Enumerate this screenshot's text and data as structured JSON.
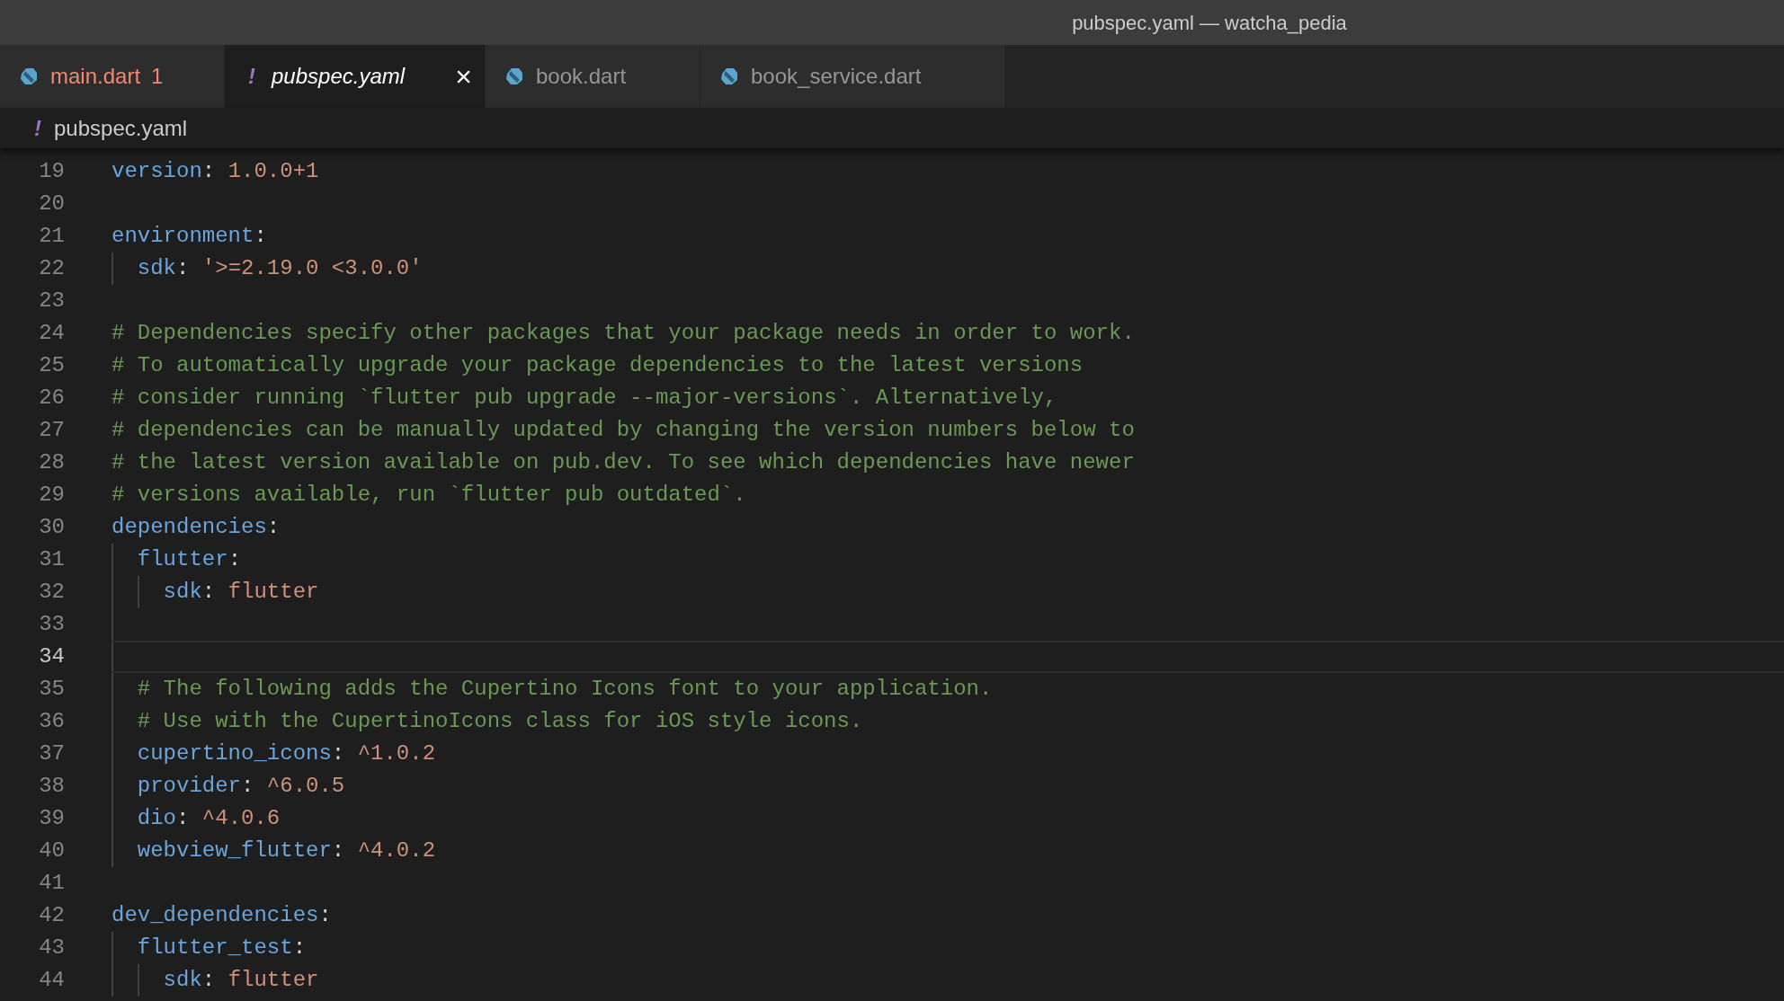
{
  "window": {
    "title": "pubspec.yaml — watcha_pedia"
  },
  "tabs": [
    {
      "kind": "dart",
      "label": "main.dart",
      "problems": "1",
      "error": true,
      "selected": false
    },
    {
      "kind": "yaml",
      "icon_text": "!",
      "label": "pubspec.yaml",
      "close": "×",
      "error": false,
      "selected": true
    },
    {
      "kind": "dart",
      "label": "book.dart",
      "error": false,
      "selected": false
    },
    {
      "kind": "dart",
      "label": "book_service.dart",
      "error": false,
      "selected": false
    }
  ],
  "breadcrumb": {
    "icon_text": "!",
    "label": "pubspec.yaml"
  },
  "editor": {
    "lines": [
      {
        "number": "19",
        "tokens": [
          {
            "kind": "key",
            "text": "version"
          },
          {
            "kind": "punct",
            "text": ": "
          },
          {
            "kind": "value",
            "text": "1.0.0+1"
          }
        ]
      },
      {
        "number": "20"
      },
      {
        "number": "21",
        "tokens": [
          {
            "kind": "key",
            "text": "environment"
          },
          {
            "kind": "punct",
            "text": ":"
          }
        ],
        "children": [
          {
            "number": "22",
            "tokens": [
              {
                "kind": "key",
                "text": "sdk"
              },
              {
                "kind": "punct",
                "text": ": "
              },
              {
                "kind": "value",
                "text": "'>=2.19.0 <3.0.0'"
              }
            ]
          }
        ]
      },
      {
        "number": "23"
      },
      {
        "number": "24",
        "tokens": [
          {
            "kind": "comment",
            "text": "# Dependencies specify other packages that your package needs in order to work."
          }
        ]
      },
      {
        "number": "25",
        "tokens": [
          {
            "kind": "comment",
            "text": "# To automatically upgrade your package dependencies to the latest versions"
          }
        ]
      },
      {
        "number": "26",
        "tokens": [
          {
            "kind": "comment",
            "text": "# consider running `flutter pub upgrade --major-versions`. Alternatively,"
          }
        ]
      },
      {
        "number": "27",
        "tokens": [
          {
            "kind": "comment",
            "text": "# dependencies can be manually updated by changing the version numbers below to"
          }
        ]
      },
      {
        "number": "28",
        "tokens": [
          {
            "kind": "comment",
            "text": "# the latest version available on pub.dev. To see which dependencies have newer"
          }
        ]
      },
      {
        "number": "29",
        "tokens": [
          {
            "kind": "comment",
            "text": "# versions available, run `flutter pub outdated`."
          }
        ]
      },
      {
        "number": "30",
        "tokens": [
          {
            "kind": "key",
            "text": "dependencies"
          },
          {
            "kind": "punct",
            "text": ":"
          }
        ],
        "children": [
          {
            "number": "31",
            "tokens": [
              {
                "kind": "key",
                "text": "flutter"
              },
              {
                "kind": "punct",
                "text": ":"
              }
            ],
            "children": [
              {
                "number": "32",
                "tokens": [
                  {
                    "kind": "key",
                    "text": "sdk"
                  },
                  {
                    "kind": "punct",
                    "text": ": "
                  },
                  {
                    "kind": "value",
                    "text": "flutter"
                  }
                ]
              }
            ]
          },
          {
            "number": "33"
          },
          {
            "number": "34",
            "current": true
          },
          {
            "number": "35",
            "tokens": [
              {
                "kind": "comment",
                "text": "# The following adds the Cupertino Icons font to your application."
              }
            ]
          },
          {
            "number": "36",
            "tokens": [
              {
                "kind": "comment",
                "text": "# Use with the CupertinoIcons class for iOS style icons."
              }
            ]
          },
          {
            "number": "37",
            "tokens": [
              {
                "kind": "key",
                "text": "cupertino_icons"
              },
              {
                "kind": "punct",
                "text": ": "
              },
              {
                "kind": "value",
                "text": "^1.0.2"
              }
            ]
          },
          {
            "number": "38",
            "tokens": [
              {
                "kind": "key",
                "text": "provider"
              },
              {
                "kind": "punct",
                "text": ": "
              },
              {
                "kind": "value",
                "text": "^6.0.5"
              }
            ]
          },
          {
            "number": "39",
            "tokens": [
              {
                "kind": "key",
                "text": "dio"
              },
              {
                "kind": "punct",
                "text": ": "
              },
              {
                "kind": "value",
                "text": "^4.0.6"
              }
            ]
          },
          {
            "number": "40",
            "tokens": [
              {
                "kind": "key",
                "text": "webview_flutter"
              },
              {
                "kind": "punct",
                "text": ": "
              },
              {
                "kind": "value",
                "text": "^4.0.2"
              }
            ]
          }
        ]
      },
      {
        "number": "41"
      },
      {
        "number": "42",
        "tokens": [
          {
            "kind": "key",
            "text": "dev_dependencies"
          },
          {
            "kind": "punct",
            "text": ":"
          }
        ],
        "children": [
          {
            "number": "43",
            "tokens": [
              {
                "kind": "key",
                "text": "flutter_test"
              },
              {
                "kind": "punct",
                "text": ":"
              }
            ],
            "children": [
              {
                "number": "44",
                "tokens": [
                  {
                    "kind": "key",
                    "text": "sdk"
                  },
                  {
                    "kind": "punct",
                    "text": ": "
                  },
                  {
                    "kind": "value",
                    "text": "flutter"
                  }
                ]
              }
            ]
          }
        ]
      }
    ]
  }
}
